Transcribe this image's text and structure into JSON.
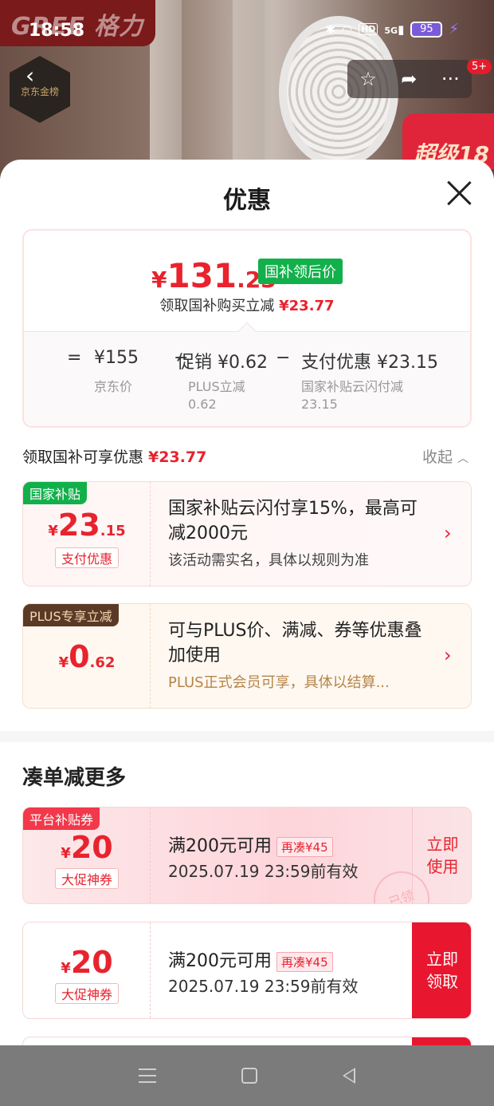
{
  "status": {
    "time": "18:58",
    "battery": "95",
    "net": "5G",
    "hd": "HD"
  },
  "header": {
    "brand_text": "GREE 格力",
    "badge_text": "京东金榜",
    "more_count": "5+",
    "promo_text": "超级18"
  },
  "sheet": {
    "title": "优惠"
  },
  "price": {
    "symbol": "¥",
    "integer": "131",
    "decimal": ".23",
    "tag": "国补领后价",
    "sub_label": "领取国补购买立减",
    "sub_value": "¥23.77",
    "eq": "=",
    "items": [
      {
        "value": "¥155",
        "label": "京东价",
        "sub": ""
      },
      {
        "op": "−",
        "value": "促销 ¥0.62",
        "label": "PLUS立减",
        "sub": "0.62"
      },
      {
        "op": "−",
        "value": "支付优惠 ¥23.15",
        "label": "国家补贴云闪付减",
        "sub": "23.15"
      }
    ]
  },
  "discount_section": {
    "title": "领取国补可享优惠",
    "value": "¥23.77",
    "collapse": "收起"
  },
  "coupons": [
    {
      "corner": "国家补贴",
      "symbol": "¥",
      "integer": "23",
      "decimal": ".15",
      "type": "支付优惠",
      "title": "国家补贴云闪付享15%，最高可减2000元",
      "sub": "该活动需实名，具体以规则为准"
    },
    {
      "corner": "PLUS专享立减",
      "symbol": "¥",
      "integer": "0",
      "decimal": ".62",
      "type": "",
      "title": "可与PLUS价、满减、券等优惠叠加使用",
      "sub": "PLUS正式会员可享，具体以结算..."
    }
  ],
  "more_section": {
    "title": "凑单减更多"
  },
  "coupons2": [
    {
      "corner": "平台补贴券",
      "symbol": "¥",
      "amount": "20",
      "type": "大促神券",
      "title": "满200元可用",
      "tag": "再凑¥45",
      "date": "2025.07.19 23:59前有效",
      "button": "立即使用",
      "stamp": "已领"
    },
    {
      "corner": "",
      "symbol": "¥",
      "amount": "20",
      "type": "大促神券",
      "title": "满200元可用",
      "tag": "再凑¥45",
      "date": "2025.07.19 23:59前有效",
      "button": "立即领取",
      "stamp": ""
    }
  ],
  "colors": {
    "accent_red": "#e8232e",
    "green": "#12b04b",
    "plus_brown": "#5a3a26"
  }
}
